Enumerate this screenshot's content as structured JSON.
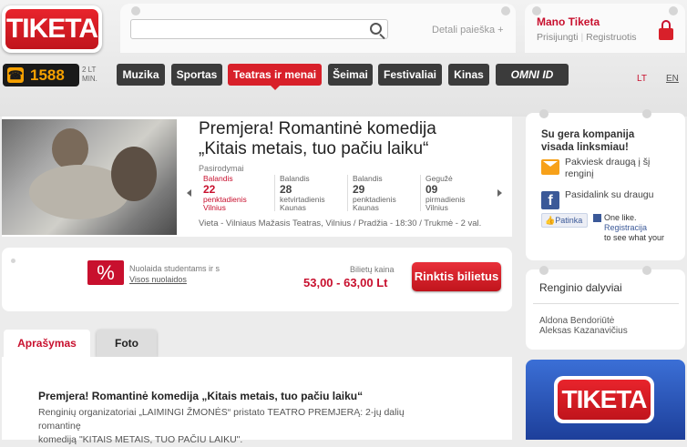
{
  "logo": "TIKETA",
  "search": {
    "placeholder": "",
    "detail_link": "Detali paieška +"
  },
  "user": {
    "title": "Mano Tiketa",
    "login": "Prisijungti",
    "register": "Registruotis"
  },
  "phone": {
    "number": "1588",
    "price_top": "2 LT",
    "price_bottom": "MIN."
  },
  "nav": {
    "items": [
      {
        "label": "Muzika"
      },
      {
        "label": "Sportas"
      },
      {
        "label": "Teatras ir menai"
      },
      {
        "label": "Šeimai"
      },
      {
        "label": "Festivaliai"
      },
      {
        "label": "Kinas"
      },
      {
        "label": "OMNI ID"
      }
    ]
  },
  "lang": {
    "lt": "LT",
    "en": "EN"
  },
  "event": {
    "title_line1": "Premjera! Romantinė komedija",
    "title_line2": "„Kitais metais, tuo pačiu laiku“",
    "shows_label": "Pasirodymai",
    "dates": [
      {
        "month": "Balandis",
        "day": "22",
        "weekday": "penktadienis",
        "city": "Vilnius"
      },
      {
        "month": "Balandis",
        "day": "28",
        "weekday": "ketvirtadienis",
        "city": "Kaunas"
      },
      {
        "month": "Balandis",
        "day": "29",
        "weekday": "penktadienis",
        "city": "Kaunas"
      },
      {
        "month": "Gegužė",
        "day": "09",
        "weekday": "pirmadienis",
        "city": "Vilnius"
      }
    ],
    "venue": "Vieta - Vilniaus Mažasis Teatras, Vilnius / Pradžia - 18:30 / Trukmė - 2 val."
  },
  "ticket": {
    "discount_symbol": "%",
    "discount_text": "Nuolaida studentams ir s",
    "discount_link": "Visos nuolaidos",
    "price_label": "Bilietų kaina",
    "price": "53,00 - 63,00 Lt",
    "buy_button": "Rinktis bilietus"
  },
  "tabs": {
    "description": "Aprašymas",
    "photo": "Foto"
  },
  "description": {
    "title": "Premjera! Romantinė komedija „Kitais metais, tuo pačiu laiku“",
    "line1": "Renginių organizatoriai „LAIMINGI ŽMONĖS“ pristato  TEATRO PREMJERĄ:  2-jų dalių romantinę",
    "line2": "komediją  \"KITAIS METAIS, TUO PAČIU LAIKU\"."
  },
  "share": {
    "title_line1": "Su gera kompanija",
    "title_line2": "visada linksmiau!",
    "invite_line1": "Pakviesk draugą į šį",
    "invite_line2": "renginį",
    "fb_share": "Pasidalink su draugu",
    "like_button": "Patinka",
    "like_line1": "One like.",
    "like_line2": "Registracija",
    "like_line3": "to see what your"
  },
  "participants": {
    "title": "Renginio dalyviai",
    "names": [
      "Aldona Bendoriūtė",
      "Aleksas Kazanavičius"
    ]
  },
  "promo": {
    "logo": "TIKETA"
  }
}
